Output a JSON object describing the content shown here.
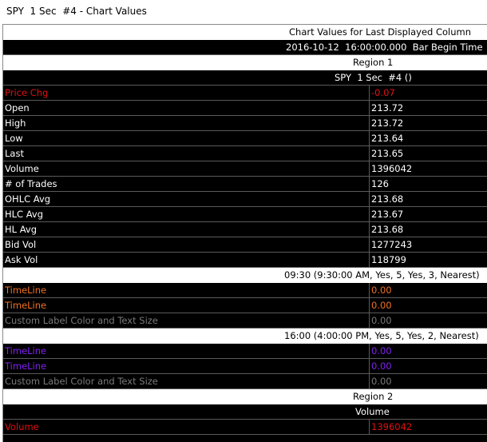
{
  "window": {
    "title": "SPY  1 Sec  #4 - Chart Values"
  },
  "colors": {
    "red": "#e01010",
    "orange": "#f07020",
    "purple": "#8020f0",
    "gray": "#7a7a7a",
    "white": "#ffffff"
  },
  "header": {
    "line1": "Chart Values for Last Displayed Column",
    "line2": "2016-10-12  16:00:00.000  Bar Begin Time"
  },
  "region1": {
    "label": "Region 1",
    "symbol": "SPY  1 Sec  #4 ()",
    "rows": [
      {
        "label": "Price Chg",
        "value": "-0.07",
        "color": "#e01010"
      },
      {
        "label": "Open",
        "value": "213.72",
        "color": "#ffffff"
      },
      {
        "label": "High",
        "value": "213.72",
        "color": "#ffffff"
      },
      {
        "label": "Low",
        "value": "213.64",
        "color": "#ffffff"
      },
      {
        "label": "Last",
        "value": "213.65",
        "color": "#ffffff"
      },
      {
        "label": "Volume",
        "value": "1396042",
        "color": "#ffffff"
      },
      {
        "label": "# of Trades",
        "value": "126",
        "color": "#ffffff"
      },
      {
        "label": "OHLC Avg",
        "value": "213.68",
        "color": "#ffffff"
      },
      {
        "label": "HLC Avg",
        "value": "213.67",
        "color": "#ffffff"
      },
      {
        "label": "HL Avg",
        "value": "213.68",
        "color": "#ffffff"
      },
      {
        "label": "Bid Vol",
        "value": "1277243",
        "color": "#ffffff"
      },
      {
        "label": "Ask Vol",
        "value": "118799",
        "color": "#ffffff"
      }
    ],
    "study1": {
      "label": "09:30 (9:30:00 AM, Yes, 5, Yes, 3, Nearest)",
      "rows": [
        {
          "label": "TimeLine",
          "value": "0.00",
          "color": "#f07020"
        },
        {
          "label": "TimeLine",
          "value": "0.00",
          "color": "#f07020"
        },
        {
          "label": "Custom Label Color and Text Size",
          "value": "0.00",
          "color": "#7a7a7a"
        }
      ]
    },
    "study2": {
      "label": "16:00 (4:00:00 PM, Yes, 5, Yes, 2, Nearest)",
      "rows": [
        {
          "label": "TimeLine",
          "value": "0.00",
          "color": "#8020f0"
        },
        {
          "label": "TimeLine",
          "value": "0.00",
          "color": "#8020f0"
        },
        {
          "label": "Custom Label Color and Text Size",
          "value": "0.00",
          "color": "#7a7a7a"
        }
      ]
    }
  },
  "region2": {
    "label": "Region 2",
    "study": {
      "label": "Volume",
      "rows": [
        {
          "label": "Volume",
          "value": "1396042",
          "color": "#e01010"
        }
      ]
    }
  }
}
